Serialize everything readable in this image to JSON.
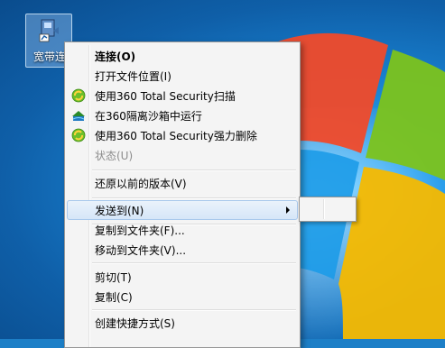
{
  "desktop": {
    "icon": {
      "name": "broadband-shortcut-icon",
      "label": "宽带连"
    }
  },
  "context_menu": {
    "items": [
      {
        "label": "连接(O)"
      },
      {
        "label": "打开文件位置(I)"
      },
      {
        "label": "使用360 Total Security扫描",
        "icon": "360-total-security-icon"
      },
      {
        "label": "在360隔离沙箱中运行",
        "icon": "360-sandbox-icon"
      },
      {
        "label": "使用360 Total Security强力删除",
        "icon": "360-total-security-icon"
      },
      {
        "label": "状态(U)"
      },
      {
        "label": "还原以前的版本(V)"
      },
      {
        "label": "发送到(N)"
      },
      {
        "label": "复制到文件夹(F)..."
      },
      {
        "label": "移动到文件夹(V)..."
      },
      {
        "label": "剪切(T)"
      },
      {
        "label": "复制(C)"
      },
      {
        "label": "创建快捷方式(S)"
      }
    ]
  },
  "colors": {
    "desktop_blue": "#1a86d6",
    "menu_bg": "#f4f4f4",
    "hover_border": "#a8c8ec"
  }
}
